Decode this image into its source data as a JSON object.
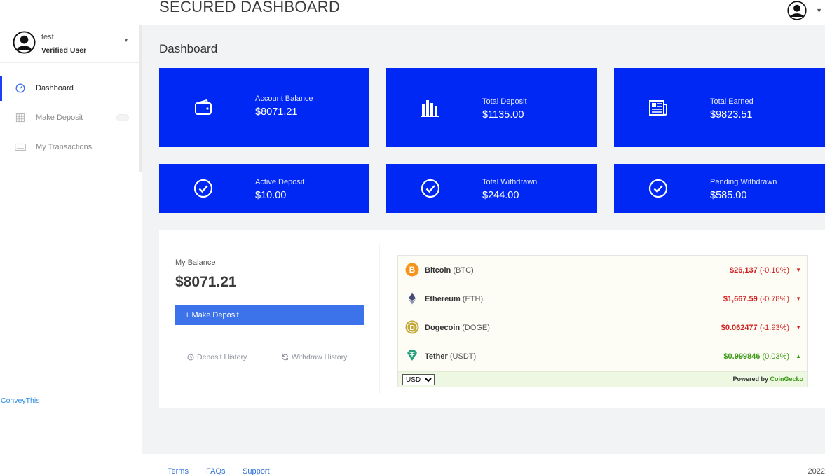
{
  "header": {
    "title": "SECURED DASHBOARD"
  },
  "user": {
    "name": "test",
    "role": "Verified User"
  },
  "sidebar": {
    "items": [
      {
        "label": "Dashboard",
        "icon": "gauge-icon",
        "active": true
      },
      {
        "label": "Make Deposit",
        "icon": "grid-icon",
        "active": false
      },
      {
        "label": "My Transactions",
        "icon": "keyboard-icon",
        "active": false
      }
    ],
    "convey_link": "ConveyThis"
  },
  "page": {
    "title": "Dashboard"
  },
  "cards": [
    {
      "label": "Account Balance",
      "value": "$8071.21",
      "icon": "wallet-icon"
    },
    {
      "label": "Total Deposit",
      "value": "$1135.00",
      "icon": "bar-chart-icon"
    },
    {
      "label": "Total Earned",
      "value": "$9823.51",
      "icon": "newspaper-icon"
    },
    {
      "label": "Active Deposit",
      "value": "$10.00",
      "icon": "check-circle-icon"
    },
    {
      "label": "Total Withdrawn",
      "value": "$244.00",
      "icon": "check-circle-icon"
    },
    {
      "label": "Pending Withdrawn",
      "value": "$585.00",
      "icon": "check-circle-icon"
    }
  ],
  "balance": {
    "label": "My Balance",
    "value": "$8071.21",
    "deposit_button": "+ Make Deposit",
    "deposit_history": "Deposit History",
    "withdraw_history": "Withdraw History"
  },
  "ticker": {
    "coins": [
      {
        "name": "Bitcoin",
        "symbol": "(BTC)",
        "price": "$26,137",
        "change": "(-0.10%)",
        "direction": "down",
        "color": "#f7931a"
      },
      {
        "name": "Ethereum",
        "symbol": "(ETH)",
        "price": "$1,667.59",
        "change": "(-0.78%)",
        "direction": "down",
        "color": "#627eea"
      },
      {
        "name": "Dogecoin",
        "symbol": "(DOGE)",
        "price": "$0.062477",
        "change": "(-1.93%)",
        "direction": "down",
        "color": "#c2a633"
      },
      {
        "name": "Tether",
        "symbol": "(USDT)",
        "price": "$0.999846",
        "change": "(0.03%)",
        "direction": "up",
        "color": "#26a17b"
      }
    ],
    "currency": "USD",
    "powered_prefix": "Powered by ",
    "powered_brand": "CoinGecko"
  },
  "footer": {
    "links": [
      "Terms",
      "FAQs",
      "Support"
    ],
    "year": "2022"
  },
  "colors": {
    "accent": "#0028f5",
    "button": "#3d73ea",
    "negative": "#d42020",
    "positive": "#3c9a16"
  }
}
